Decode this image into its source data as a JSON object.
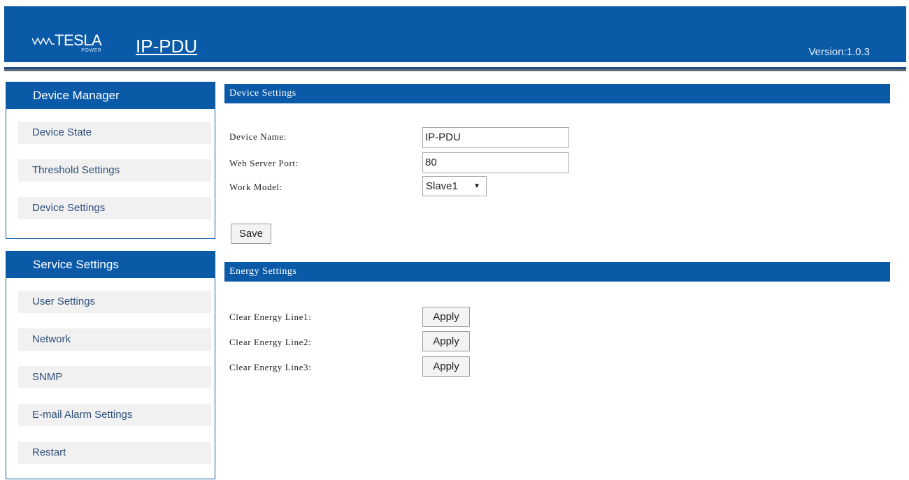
{
  "header": {
    "brand_logo_text": "TESLA",
    "brand_logo_subtext": "POWER",
    "product_title": "IP-PDU",
    "version": "Version:1.0.3"
  },
  "sidebar": {
    "device_manager": {
      "title": "Device Manager",
      "items": [
        "Device State",
        "Threshold Settings",
        "Device Settings"
      ]
    },
    "service_settings": {
      "title": "Service Settings",
      "items": [
        "User Settings",
        "Network",
        "SNMP",
        "E-mail Alarm Settings",
        "Restart"
      ]
    }
  },
  "device_settings": {
    "title": "Device Settings",
    "device_name_label": "Device Name:",
    "device_name_value": "IP-PDU",
    "web_port_label": "Web Server Port:",
    "web_port_value": "80",
    "work_model_label": "Work Model:",
    "work_model_value": "Slave1",
    "save_label": "Save"
  },
  "energy_settings": {
    "title": "Energy Settings",
    "lines": [
      {
        "label": "Clear Energy Line1:",
        "button": "Apply"
      },
      {
        "label": "Clear Energy Line2:",
        "button": "Apply"
      },
      {
        "label": "Clear Energy Line3:",
        "button": "Apply"
      }
    ]
  },
  "colors": {
    "primary_blue": "#0a5aa8",
    "menu_item_bg": "#f1f1f1"
  }
}
